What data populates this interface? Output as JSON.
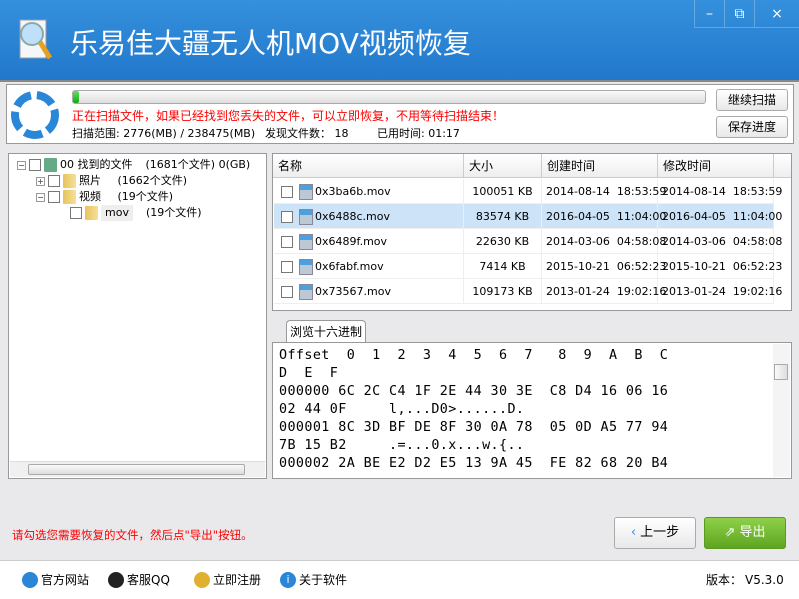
{
  "window": {
    "title": "乐易佳大疆无人机MOV视频恢复",
    "controls": {
      "minimize": "–",
      "restore": "⧉",
      "close": "×"
    }
  },
  "scan": {
    "progress_percent": 1,
    "message": "正在扫描文件，如果已经找到您丢失的文件，可以立即恢复，不用等待扫描结束！",
    "range_label": "扫描范围:",
    "range_value": "2776(MB) / 238475(MB)",
    "found_label": "发现文件数：",
    "found_value": "18",
    "elapsed_label": "已用时间:",
    "elapsed_value": "01:17",
    "continue_button": "继续扫描",
    "save_button": "保存进度"
  },
  "tree": {
    "root": {
      "label": "00  找到的文件",
      "count": "(1681个文件)  0(GB)"
    },
    "photos": {
      "label": "照片",
      "count": "(1662个文件)"
    },
    "video": {
      "label": "视频",
      "count": "(19个文件)"
    },
    "mov": {
      "label": "mov",
      "count": "(19个文件)"
    }
  },
  "list": {
    "columns": [
      "名称",
      "大小",
      "创建时间",
      "修改时间"
    ],
    "rows": [
      {
        "name": "0x3ba6b.mov",
        "size": "100051 KB",
        "created": "2014-08-14  18:53:59",
        "modified": "2014-08-14  18:53:59"
      },
      {
        "name": "0x6488c.mov",
        "size": "83574 KB",
        "created": "2016-04-05  11:04:00",
        "modified": "2016-04-05  11:04:00"
      },
      {
        "name": "0x6489f.mov",
        "size": "22630 KB",
        "created": "2014-03-06  04:58:08",
        "modified": "2014-03-06  04:58:08"
      },
      {
        "name": "0x6fabf.mov",
        "size": "7414 KB",
        "created": "2015-10-21  06:52:23",
        "modified": "2015-10-21  06:52:23"
      },
      {
        "name": "0x73567.mov",
        "size": "109173 KB",
        "created": "2013-01-24  19:02:16",
        "modified": "2013-01-24  19:02:16"
      }
    ]
  },
  "hex": {
    "tab": "浏览十六进制",
    "lines": [
      "Offset  0  1  2  3  4  5  6  7   8  9  A  B  C",
      "D  E  F",
      "000000 6C 2C C4 1F 2E 44 30 3E  C8 D4 16 06 16",
      "02 44 0F     l,...D0>......D.",
      "000001 8C 3D BF DE 8F 30 0A 78  05 0D A5 77 94",
      "7B 15 B2     .=...0.x...w.{..",
      "000002 2A BE E2 D2 E5 13 9A 45  FE 82 68 20 B4"
    ]
  },
  "hint": "请勾选您需要恢复的文件，然后点\"导出\"按钮。",
  "buttons": {
    "back": "上一步",
    "export": "导出"
  },
  "footer": {
    "links": [
      "官方网站",
      "客服QQ",
      "立即注册",
      "关于软件"
    ],
    "version_label": "版本：",
    "version": "V5.3.0"
  },
  "colors": {
    "titlebar": "#2a86d6",
    "export": "#6cb52a",
    "warning": "#ff0000"
  }
}
